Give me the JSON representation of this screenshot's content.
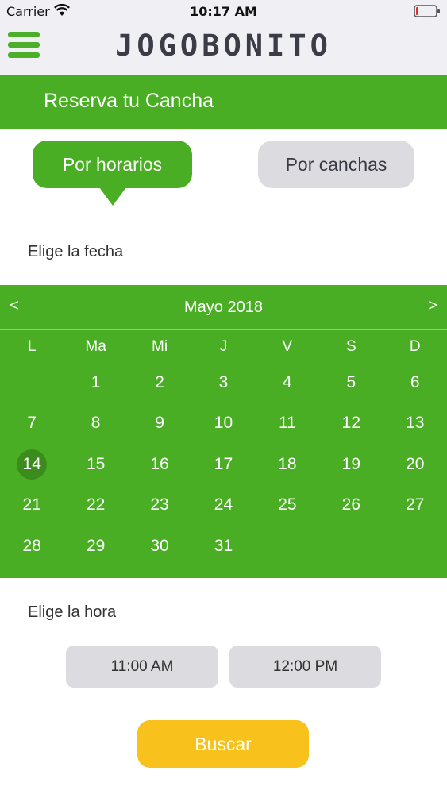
{
  "status_bar": {
    "carrier": "Carrier",
    "time": "10:17 AM"
  },
  "header": {
    "brand": "JOGOBONITO",
    "accent_color": "#4aae24"
  },
  "title": "Reserva tu Cancha",
  "tabs": [
    {
      "label": "Por horarios",
      "active": true
    },
    {
      "label": "Por canchas",
      "active": false
    }
  ],
  "date_section": {
    "label": "Elige la fecha"
  },
  "calendar": {
    "prev": "<",
    "next": ">",
    "month": "Mayo 2018",
    "weekdays": [
      "L",
      "Ma",
      "Mi",
      "J",
      "V",
      "S",
      "D"
    ],
    "weeks": [
      [
        "",
        "1",
        "2",
        "3",
        "4",
        "5",
        "6"
      ],
      [
        "7",
        "8",
        "9",
        "10",
        "11",
        "12",
        "13"
      ],
      [
        "14",
        "15",
        "16",
        "17",
        "18",
        "19",
        "20"
      ],
      [
        "21",
        "22",
        "23",
        "24",
        "25",
        "26",
        "27"
      ],
      [
        "28",
        "29",
        "30",
        "31",
        "",
        "",
        ""
      ]
    ],
    "selected_day": "14"
  },
  "time_section": {
    "label": "Elige la hora",
    "slots": [
      "11:00 AM",
      "12:00 PM"
    ]
  },
  "search_button": "Buscar",
  "colors": {
    "green": "#4aae24",
    "button_yellow": "#f8c11c",
    "chip_gray": "#dcdce0"
  }
}
